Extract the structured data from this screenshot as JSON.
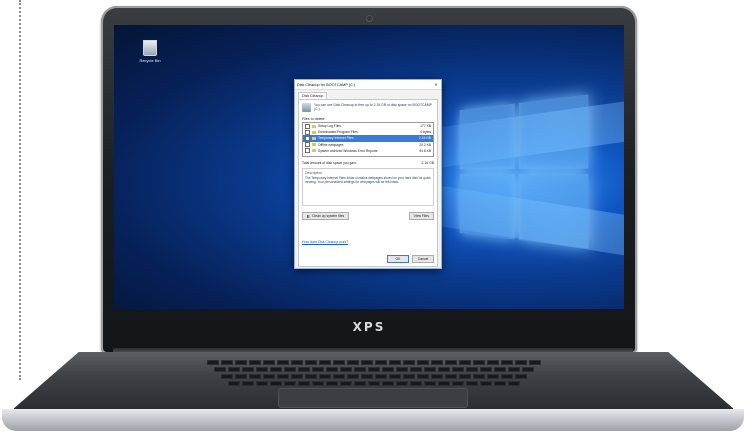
{
  "desktop": {
    "recycle_bin_label": "Recycle Bin"
  },
  "dialog": {
    "title": "Disk Cleanup for BOOTCAMP (C:)",
    "close_glyph": "✕",
    "tab_label": "Disk Cleanup",
    "intro_text": "You can use Disk Cleanup to free up to 2.15 GB of disk space on BOOTCAMP (C:).",
    "files_to_delete_label": "Files to delete:",
    "files": [
      {
        "name": "Setup Log Files",
        "size": "177 KB",
        "selected": false
      },
      {
        "name": "Downloaded Program Files",
        "size": "0 bytes",
        "selected": false
      },
      {
        "name": "Temporary Internet Files",
        "size": "2.15 GB",
        "selected": true
      },
      {
        "name": "Offline webpages",
        "size": "20.2 KB",
        "selected": false
      },
      {
        "name": "System archived Windows Error Reports",
        "size": "94.8 KB",
        "selected": false
      }
    ],
    "total_label": "Total amount of disk space you gain:",
    "total_value": "2.16 GB",
    "description_title": "Description",
    "description_text": "The Temporary Internet Files folder contains webpages stored on your hard disk for quick viewing. Your personalized settings for webpages will be left intact.",
    "cleanup_system_label": "Clean up system files",
    "view_files_label": "View Files",
    "help_link": "How does Disk Cleanup work?",
    "ok_label": "OK",
    "cancel_label": "Cancel"
  },
  "laptop": {
    "brand": "XPS"
  },
  "colors": {
    "selection": "#3a7bd5",
    "desktop_blue": "#0a3a8d"
  }
}
